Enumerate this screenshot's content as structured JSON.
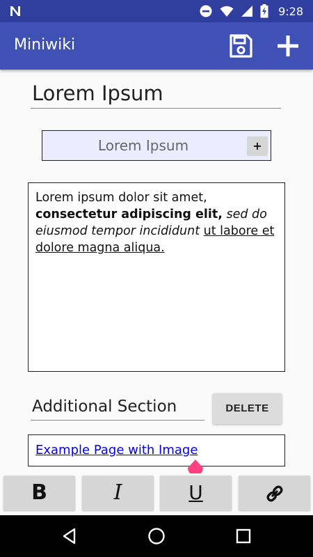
{
  "status_bar": {
    "time": "9:28",
    "icons": [
      "n-icon",
      "do-not-disturb-icon",
      "wifi-icon",
      "signal-icon",
      "battery-charging-icon"
    ]
  },
  "app_bar": {
    "title": "Miniwiki",
    "actions": [
      "save-icon",
      "add-icon"
    ]
  },
  "editor": {
    "page_title": "Lorem Ipsum",
    "title_chip": {
      "label": "Lorem Ipsum",
      "add_label": "+"
    },
    "content": {
      "segment_plain": "Lorem ipsum dolor sit amet,",
      "segment_bold": "consectetur adipiscing elit,",
      "segment_italic": "sed do eiusmod tempor incididunt",
      "segment_underline": "ut labore et dolore magna aliqua."
    },
    "section": {
      "title": "Additional Section",
      "delete_label": "DELETE"
    },
    "link": {
      "text": "Example Page with Image"
    }
  },
  "format_bar": {
    "bold_label": "B",
    "italic_label": "I",
    "underline_label": "U",
    "link_icon": "link-icon"
  },
  "nav_bar": {
    "items": [
      "back-icon",
      "home-icon",
      "recents-icon"
    ]
  },
  "colors": {
    "status_bar": "#303f9f",
    "app_bar": "#3f51b5",
    "accent": "#ff4081",
    "link": "#0000ee"
  }
}
